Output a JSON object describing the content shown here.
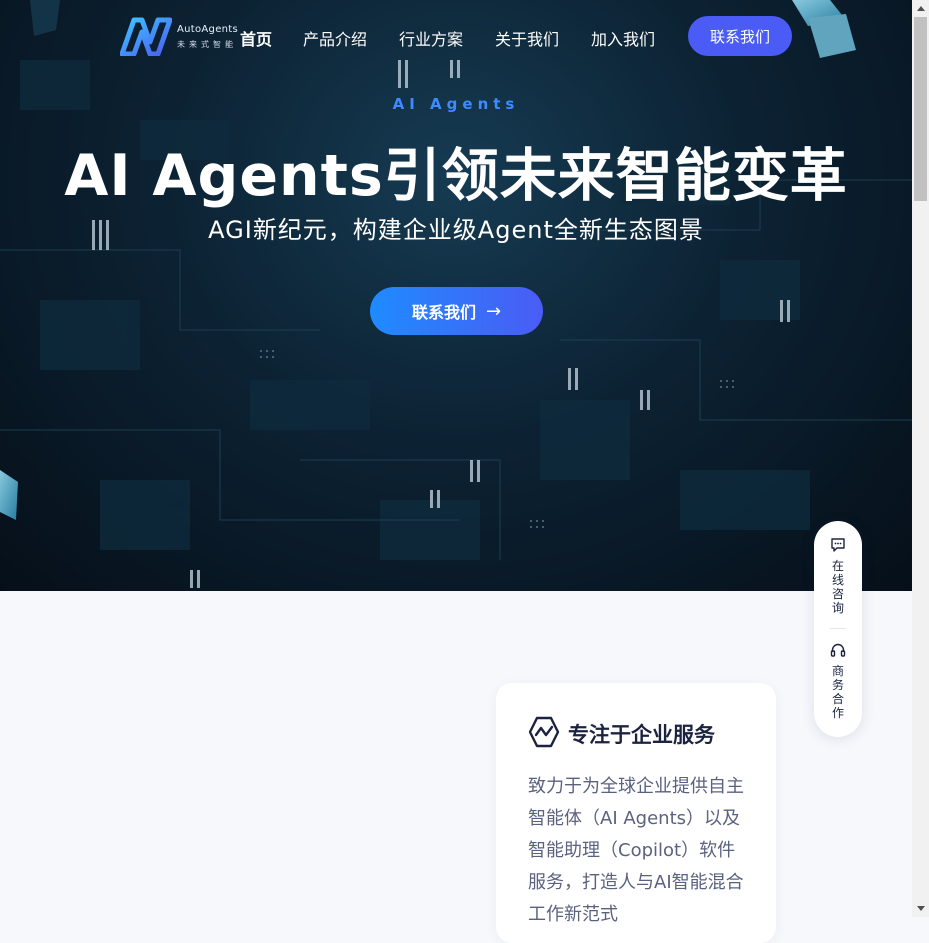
{
  "logo": {
    "brand": "AutoAgents",
    "tagline": "未来式智能"
  },
  "nav": {
    "items": [
      {
        "label": "首页",
        "active": true
      },
      {
        "label": "产品介绍",
        "active": false
      },
      {
        "label": "行业方案",
        "active": false
      },
      {
        "label": "关于我们",
        "active": false
      },
      {
        "label": "加入我们",
        "active": false
      }
    ],
    "contact_button": "联系我们"
  },
  "hero": {
    "eyebrow": "AI Agents",
    "headline": "AI Agents引领未来智能变革",
    "subheadline": "AGI新纪元，构建企业级Agent全新生态图景",
    "cta_label": "联系我们"
  },
  "card": {
    "title": "专注于企业服务",
    "body": "致力于为全球企业提供自主智能体（AI Agents）以及智能助理（Copilot）软件服务，打造人与AI智能混合工作新范式"
  },
  "float_panel": {
    "consult_label": "在线咨询",
    "business_label": "商务合作"
  },
  "colors": {
    "accent": "#4a5cf5",
    "accent_light": "#1f8bff",
    "eyebrow": "#3d8bff",
    "hero_bg": "#0c2233"
  },
  "icons": {
    "cta": "arrow-right-icon",
    "card": "chart-wave-icon",
    "consult": "chat-bubble-icon",
    "business": "headset-icon"
  }
}
